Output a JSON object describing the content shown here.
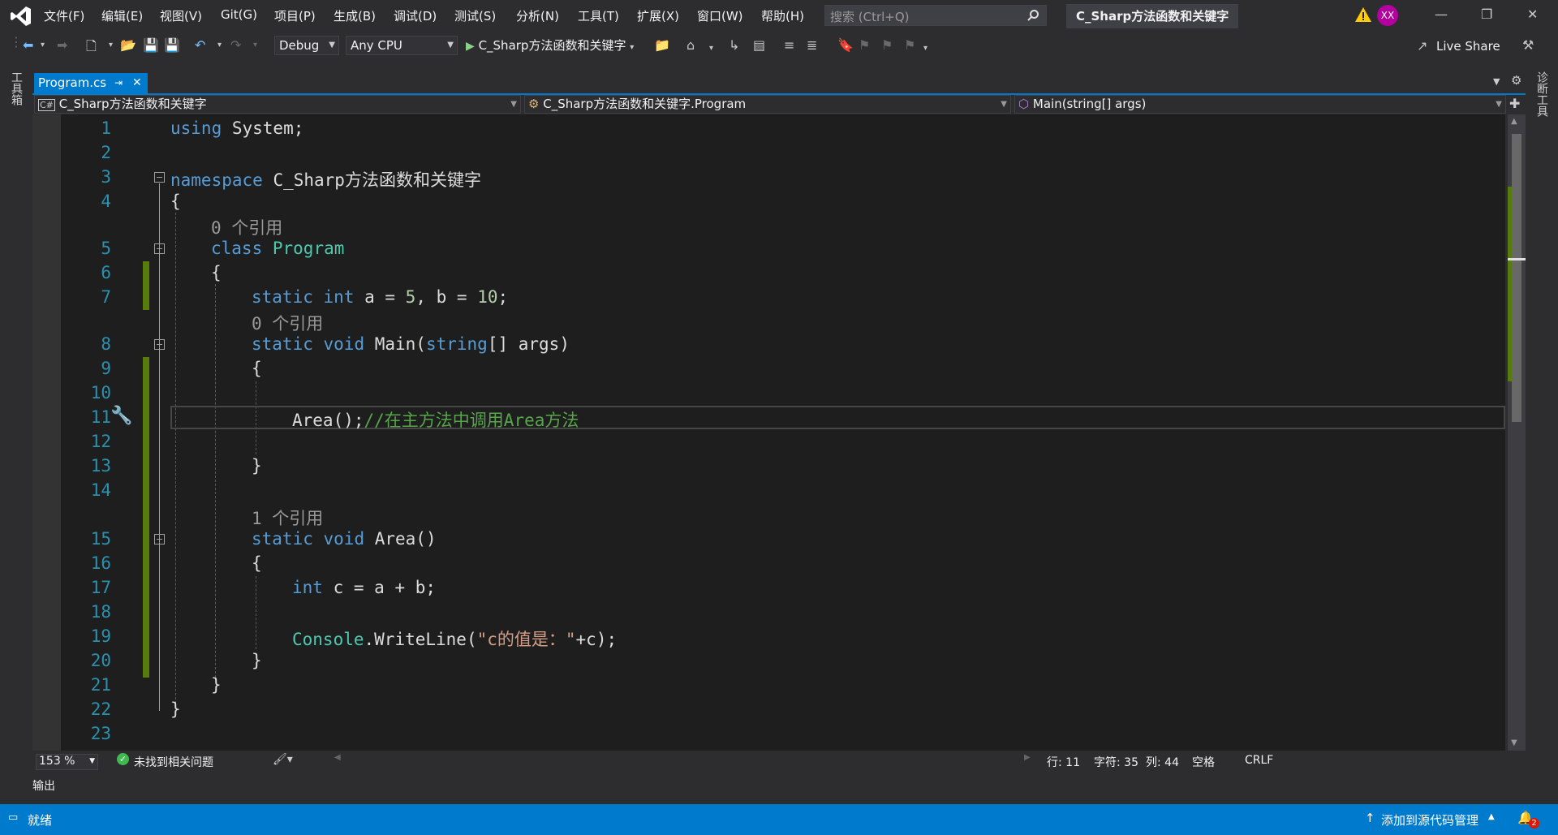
{
  "menu": [
    "文件(F)",
    "编辑(E)",
    "视图(V)",
    "Git(G)",
    "项目(P)",
    "生成(B)",
    "调试(D)",
    "测试(S)",
    "分析(N)",
    "工具(T)",
    "扩展(X)",
    "窗口(W)",
    "帮助(H)"
  ],
  "search": {
    "placeholder": "搜索 (Ctrl+Q)"
  },
  "solution_title": "C_Sharp方法函数和关键字",
  "avatar": "XX",
  "toolbar": {
    "config": "Debug",
    "platform": "Any CPU",
    "run_target": "C_Sharp方法函数和关键字",
    "live_share": "Live Share"
  },
  "side": {
    "left": "工具箱",
    "right": "诊断工具"
  },
  "tab": {
    "name": "Program.cs"
  },
  "nav": {
    "project": "C_Sharp方法函数和关键字",
    "class": "C_Sharp方法函数和关键字.Program",
    "member": "Main(string[] args)"
  },
  "code": {
    "l1_a": "using",
    "l1_b": " System;",
    "l3_a": "namespace",
    "l3_b": " C_Sharp方法函数和关键字",
    "l4": "{",
    "ref0a": "0 个引用",
    "l5_a": "class",
    "l5_b": "Program",
    "l6": "{",
    "l7_a": "static",
    "l7_b": "int",
    "l7_c": " a = ",
    "l7_d": "5",
    "l7_e": ", b = ",
    "l7_f": "10",
    "l7_g": ";",
    "ref0b": "0 个引用",
    "l8_a": "static",
    "l8_b": "void",
    "l8_c": " Main(",
    "l8_d": "string",
    "l8_e": "[] args)",
    "l9": "{",
    "l11_a": "Area();",
    "l11_b": "//在主方法中调用Area方法",
    "l13": "}",
    "ref1": "1 个引用",
    "l15_a": "static",
    "l15_b": "void",
    "l15_c": " Area()",
    "l16": "{",
    "l17_a": "int",
    "l17_b": " c = a + b;",
    "l19_a": "Console",
    "l19_b": ".WriteLine(",
    "l19_c": "\"c的值是：\"",
    "l19_d": "+c);",
    "l20": "}",
    "l21": "}",
    "l22": "}"
  },
  "line_numbers": [
    "1",
    "2",
    "3",
    "4",
    "5",
    "6",
    "7",
    "8",
    "9",
    "10",
    "11",
    "12",
    "13",
    "14",
    "15",
    "16",
    "17",
    "18",
    "19",
    "20",
    "21",
    "22",
    "23"
  ],
  "editor_status": {
    "zoom": "153 %",
    "issues": "未找到相关问题",
    "line": "行: 11",
    "char": "字符: 35",
    "col": "列: 44",
    "spaces": "空格",
    "eol": "CRLF"
  },
  "output_label": "输出",
  "statusbar": {
    "ready": "就绪",
    "source_control": "添加到源代码管理",
    "notif_count": "2"
  }
}
